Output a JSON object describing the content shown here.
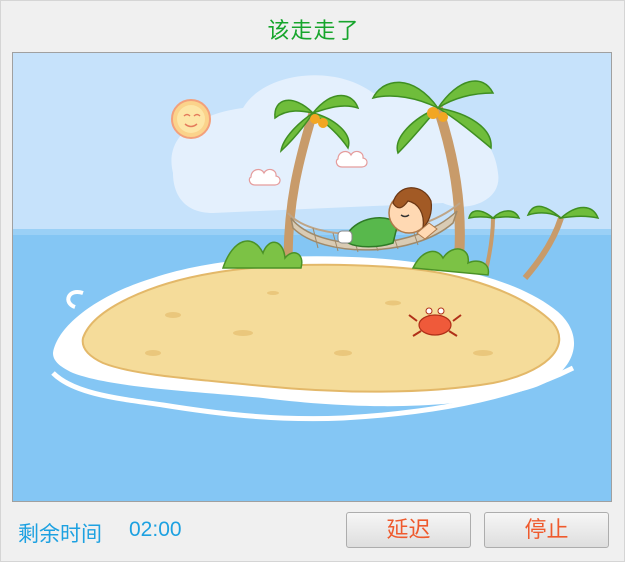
{
  "window": {
    "title": "该走走了"
  },
  "illustration": {
    "description_icon": "island-hammock-illustration"
  },
  "footer": {
    "remaining_label": "剩余时间",
    "remaining_value": "02:00",
    "delay_label": "延迟",
    "stop_label": "停止"
  },
  "colors": {
    "title": "#17a52c",
    "label": "#1da1e1",
    "button_text": "#ef5a2d"
  }
}
